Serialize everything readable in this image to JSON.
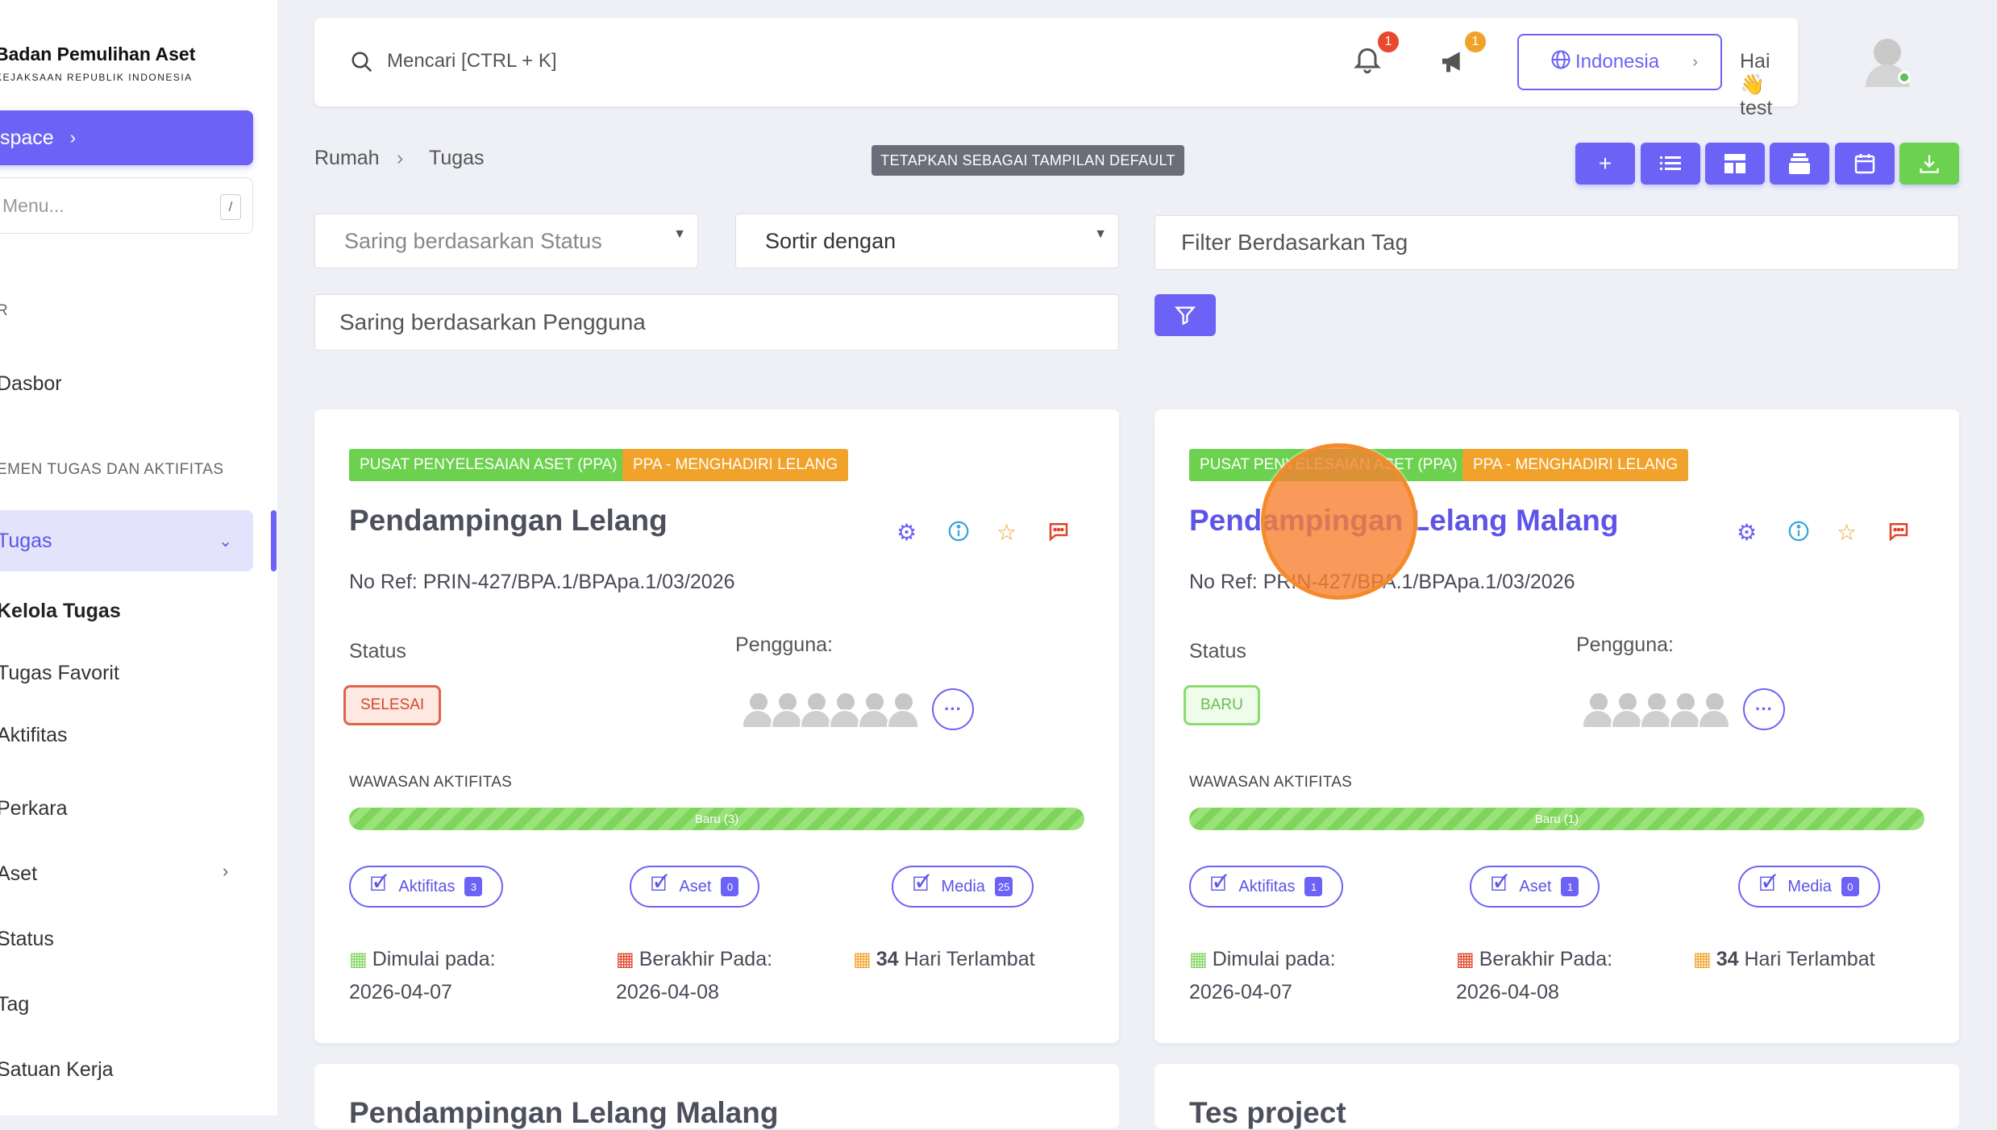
{
  "sidebar": {
    "brand_title": "Badan Pemulihan Aset",
    "brand_subtitle": "KEJAKSAAN REPUBLIK INDONESIA",
    "workspace_label": "space",
    "menu_search_placeholder": "Menu...",
    "menu_search_shortcut": "/",
    "section_1": "R",
    "dashboard": "Dasbor",
    "section_2": "EMEN TUGAS DAN AKTIFITAS",
    "active_item": "Tugas",
    "items": [
      "Kelola Tugas",
      "Tugas Favorit",
      "Aktifitas",
      "Perkara",
      "Aset",
      "Status",
      "Tag",
      "Satuan Kerja"
    ]
  },
  "topbar": {
    "search_placeholder": "Mencari [CTRL + K]",
    "notif_count": "1",
    "announce_count": "1",
    "language": "Indonesia",
    "greeting": "Hai 👋 test"
  },
  "breadcrumb": {
    "home": "Rumah",
    "current": "Tugas"
  },
  "default_view_button": "TETAPKAN SEBAGAI TAMPILAN DEFAULT",
  "filters": {
    "status_placeholder": "Saring berdasarkan Status",
    "sort_placeholder": "Sortir dengan",
    "tag_placeholder": "Filter Berdasarkan Tag",
    "user_placeholder": "Saring berdasarkan Pengguna"
  },
  "labels": {
    "status": "Status",
    "users": "Pengguna:",
    "insight": "WAWASAN AKTIFITAS",
    "start": "Dimulai pada:",
    "end": "Berakhir Pada:",
    "late_suffix": "Hari Terlambat",
    "activities": "Aktifitas",
    "assets": "Aset",
    "media": "Media"
  },
  "cards": [
    {
      "tag1": "PUSAT PENYELESAIAN ASET (PPA)",
      "tag2": "PPA - MENGHADIRI LELANG",
      "title": "Pendampingan Lelang",
      "ref": "No Ref: PRIN-427/BPA.1/BPApa.1/03/2026",
      "status": "SELESAI",
      "progress": "Baru (3)",
      "activities_count": "3",
      "assets_count": "0",
      "media_count": "25",
      "start_date": "2026-04-07",
      "end_date": "2026-04-08",
      "late_days": "34"
    },
    {
      "tag1": "PUSAT PENYELESAIAN ASET (PPA)",
      "tag2": "PPA - MENGHADIRI LELANG",
      "title": "Pendampingan Lelang Malang",
      "ref": "No Ref: PRIN-427/BPA.1/BPApa.1/03/2026",
      "status": "BARU",
      "progress": "Baru (1)",
      "activities_count": "1",
      "assets_count": "1",
      "media_count": "0",
      "start_date": "2026-04-07",
      "end_date": "2026-04-08",
      "late_days": "34"
    }
  ],
  "below_cards": [
    "Pendampingan Lelang Malang",
    "Tes project"
  ],
  "colors": {
    "accent": "#6c63f6",
    "green": "#6cd14e",
    "orange": "#f1a22b",
    "danger": "#e0644a"
  }
}
